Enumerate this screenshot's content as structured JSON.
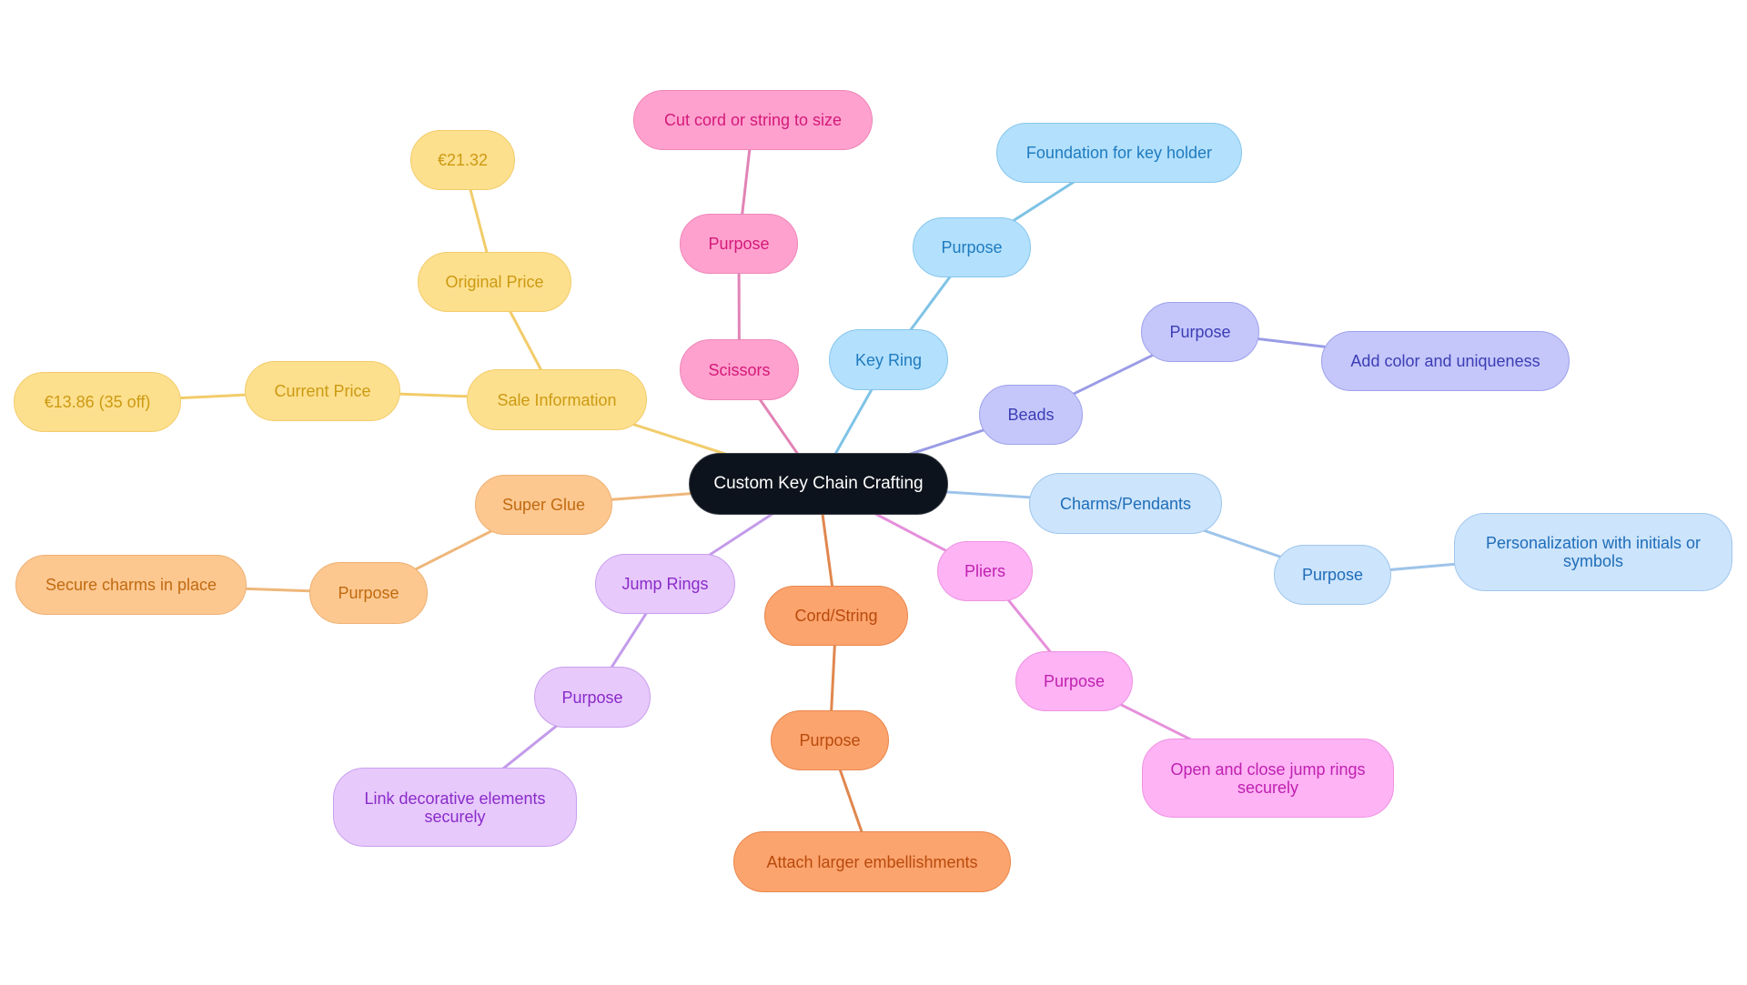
{
  "title": "Custom Key Chain Crafting",
  "branches": {
    "sale": {
      "fill": "#FDE08E",
      "border": "#F2CC6A",
      "text": "#CC9A12",
      "edge": "#F2CC6A"
    },
    "scissors": {
      "fill": "#FFA1CE",
      "border": "#EE86B8",
      "text": "#D4197A",
      "edge": "#E283B5"
    },
    "keyring": {
      "fill": "#B3E0FD",
      "border": "#86C6EC",
      "text": "#1E7BBF",
      "edge": "#7EC3E6"
    },
    "beads": {
      "fill": "#C5C7FB",
      "border": "#9EA1EA",
      "text": "#3B3DB4",
      "edge": "#9A9CE6"
    },
    "charms": {
      "fill": "#CCE4FC",
      "border": "#9FC6EC",
      "text": "#1F6DB8",
      "edge": "#9EC4EA"
    },
    "pliers": {
      "fill": "#FDB3F4",
      "border": "#EE92E2",
      "text": "#C020B0",
      "edge": "#E58FDB"
    },
    "cord": {
      "fill": "#FCA46E",
      "border": "#E8874D",
      "text": "#B84A0C",
      "edge": "#E0874E"
    },
    "jump": {
      "fill": "#E7C9FC",
      "border": "#C9A0EE",
      "text": "#8A2BC9",
      "edge": "#C39BEA"
    },
    "glue": {
      "fill": "#FDC890",
      "border": "#EDB073",
      "text": "#C06A10",
      "edge": "#EEB77A"
    },
    "root": {
      "fill": "#0D131C",
      "border": "#3A3F47",
      "text": "#FFFFFF"
    }
  },
  "nodes": {
    "root": "Custom Key Chain Crafting",
    "sale_information": "Sale Information",
    "original_price": "Original Price",
    "original_price_value": "€21.32",
    "current_price": "Current Price",
    "current_price_value": "€13.86 (35 off)",
    "scissors": "Scissors",
    "scissors_purpose": "Purpose",
    "scissors_purpose_value": "Cut cord or string to size",
    "key_ring": "Key Ring",
    "key_ring_purpose": "Purpose",
    "key_ring_purpose_value": "Foundation for key holder",
    "beads": "Beads",
    "beads_purpose": "Purpose",
    "beads_purpose_value": "Add color and uniqueness",
    "charms": "Charms/Pendants",
    "charms_purpose": "Purpose",
    "charms_purpose_value": "Personalization with initials or symbols",
    "pliers": "Pliers",
    "pliers_purpose": "Purpose",
    "pliers_purpose_value": "Open and close jump rings securely",
    "cord": "Cord/String",
    "cord_purpose": "Purpose",
    "cord_purpose_value": "Attach larger embellishments",
    "jump_rings": "Jump Rings",
    "jump_rings_purpose": "Purpose",
    "jump_rings_purpose_value": "Link decorative elements securely",
    "super_glue": "Super Glue",
    "super_glue_purpose": "Purpose",
    "super_glue_purpose_value": "Secure charms in place"
  },
  "edges": [
    [
      "root",
      "sale_information"
    ],
    [
      "sale_information",
      "original_price"
    ],
    [
      "original_price",
      "original_price_value"
    ],
    [
      "sale_information",
      "current_price"
    ],
    [
      "current_price",
      "current_price_value"
    ],
    [
      "root",
      "scissors"
    ],
    [
      "scissors",
      "scissors_purpose"
    ],
    [
      "scissors_purpose",
      "scissors_purpose_value"
    ],
    [
      "root",
      "key_ring"
    ],
    [
      "key_ring",
      "key_ring_purpose"
    ],
    [
      "key_ring_purpose",
      "key_ring_purpose_value"
    ],
    [
      "root",
      "beads"
    ],
    [
      "beads",
      "beads_purpose"
    ],
    [
      "beads_purpose",
      "beads_purpose_value"
    ],
    [
      "root",
      "charms"
    ],
    [
      "charms",
      "charms_purpose"
    ],
    [
      "charms_purpose",
      "charms_purpose_value"
    ],
    [
      "root",
      "pliers"
    ],
    [
      "pliers",
      "pliers_purpose"
    ],
    [
      "pliers_purpose",
      "pliers_purpose_value"
    ],
    [
      "root",
      "cord"
    ],
    [
      "cord",
      "cord_purpose"
    ],
    [
      "cord_purpose",
      "cord_purpose_value"
    ],
    [
      "root",
      "jump_rings"
    ],
    [
      "jump_rings",
      "jump_rings_purpose"
    ],
    [
      "jump_rings_purpose",
      "jump_rings_purpose_value"
    ],
    [
      "root",
      "super_glue"
    ],
    [
      "super_glue",
      "super_glue_purpose"
    ],
    [
      "super_glue_purpose",
      "super_glue_purpose_value"
    ]
  ]
}
